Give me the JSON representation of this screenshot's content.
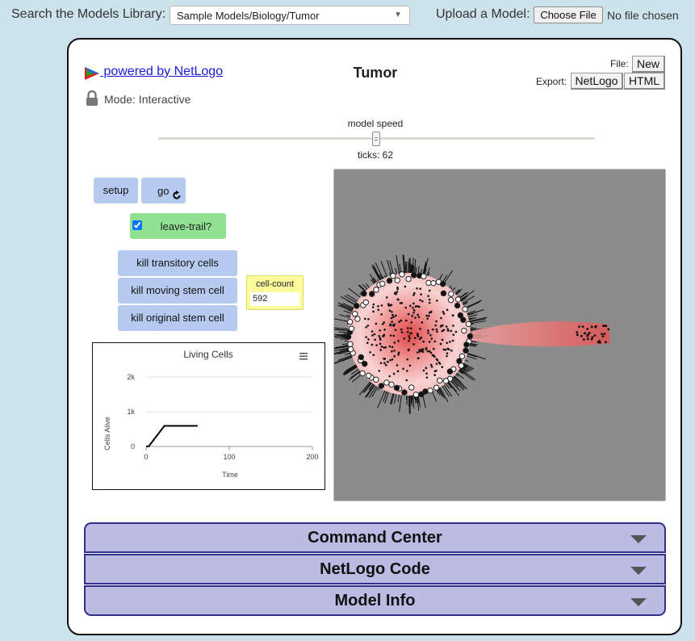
{
  "topbar": {
    "search_label": "Search the Models Library:",
    "selected_model": "Sample Models/Biology/Tumor",
    "upload_label": "Upload a Model:",
    "choose_file_label": "Choose File",
    "no_file_text": "No file chosen"
  },
  "header": {
    "powered_by": " powered by NetLogo",
    "model_title": "Tumor",
    "mode_text": "Mode: Interactive",
    "file_label": "File:",
    "new_label": "New",
    "export_label": "Export:",
    "export_netlogo": "NetLogo",
    "export_html": "HTML"
  },
  "speed": {
    "label": "model speed",
    "ticks_text": "ticks: 62",
    "slider_value": 0.5
  },
  "controls": {
    "setup_label": "setup",
    "go_label": "go",
    "leave_trail_label": "leave-trail?",
    "leave_trail_checked": true,
    "kill_transitory_label": "kill transitory cells",
    "kill_moving_label": "kill moving stem cell",
    "kill_original_label": "kill original stem cell"
  },
  "monitor": {
    "label": "cell-count",
    "value": "592"
  },
  "accordion": {
    "command_center": "Command Center",
    "netlogo_code": "NetLogo Code",
    "model_info": "Model Info"
  },
  "icons": {
    "logo": "netlogo-logo-icon",
    "lock": "lock-icon",
    "forever": "forever-icon",
    "menu": "hamburger-menu-icon",
    "expand": "triangle-down-icon"
  },
  "colors": {
    "page_bg": "#cce3ec",
    "button_blue": "#b6c9ef",
    "switch_green": "#90e290",
    "monitor_yellow": "#fdfd9c",
    "view_bg": "#8c8c8c",
    "accordion_bg": "#bbbbe4",
    "tumor_red": "#e04848"
  },
  "chart_data": {
    "type": "line",
    "title": "Living Cells",
    "xlabel": "Time",
    "ylabel": "Cells Alive",
    "xlim": [
      0,
      200
    ],
    "ylim": [
      0,
      2000
    ],
    "x_ticks": [
      "0",
      "100",
      "200"
    ],
    "y_ticks": [
      "0",
      "1k",
      "2k"
    ],
    "series": [
      {
        "x": [
          0,
          3,
          22,
          62
        ],
        "y": [
          0,
          0,
          592,
          592
        ]
      }
    ]
  }
}
